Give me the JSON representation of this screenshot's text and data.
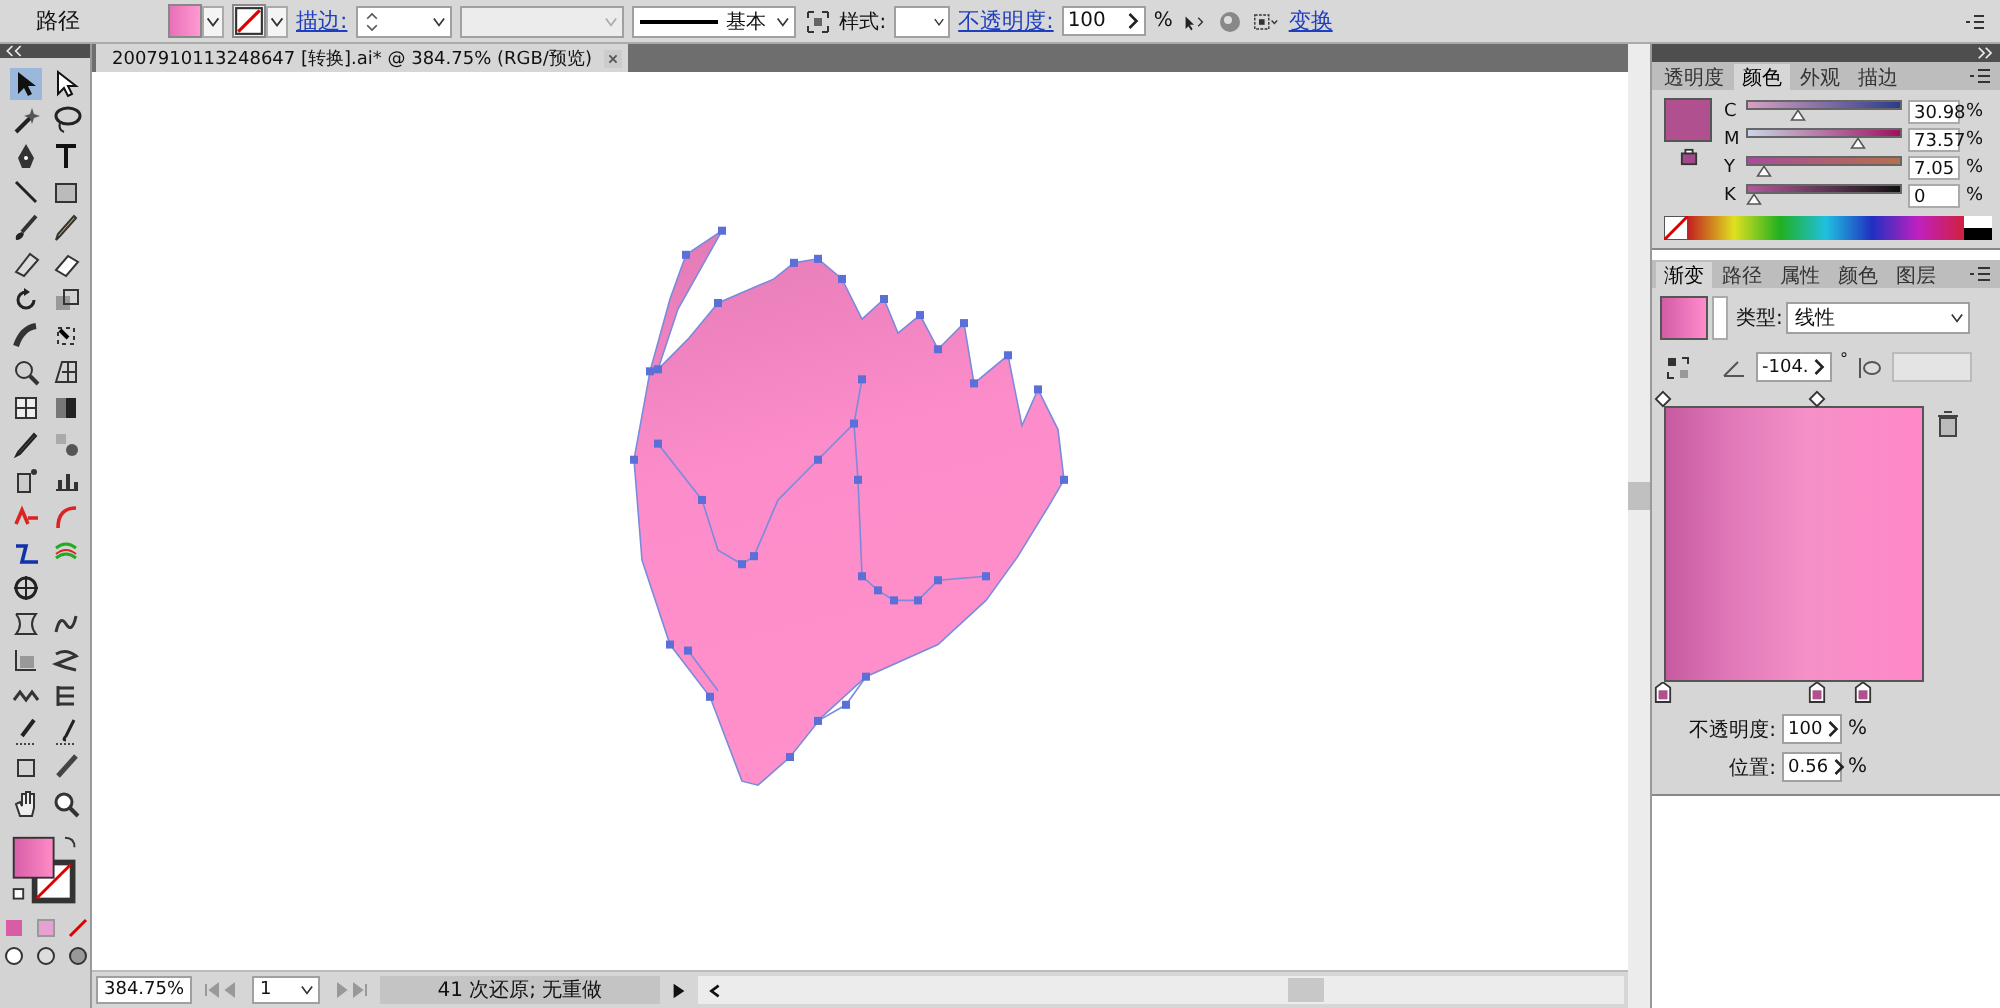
{
  "control_bar": {
    "label": "路径",
    "stroke_link": "描边:",
    "stroke_style": "基本",
    "style_label": "样式:",
    "opacity_link": "不透明度:",
    "opacity_value": "100",
    "opacity_unit": "%",
    "transform_link": "变换"
  },
  "document_tab": {
    "title": "2007910113248647  [转换].ai* @ 384.75% (RGB/预览)"
  },
  "color_panel": {
    "tabs": [
      {
        "label": "透明度",
        "selected": false
      },
      {
        "label": "颜色",
        "selected": true
      },
      {
        "label": "外观",
        "selected": false
      },
      {
        "label": "描边",
        "selected": false
      }
    ],
    "sliders": [
      {
        "name": "C",
        "level": 0.31,
        "value": "30.98",
        "unit": "%"
      },
      {
        "name": "M",
        "level": 0.74,
        "value": "73.57",
        "unit": "%"
      },
      {
        "name": "Y",
        "level": 0.07,
        "value": "7.05",
        "unit": "%"
      },
      {
        "name": "K",
        "level": 0,
        "value": "0",
        "unit": "%"
      }
    ]
  },
  "gradient_panel": {
    "tabs": [
      {
        "label": "渐变",
        "selected": true
      },
      {
        "label": "路径",
        "selected": false
      },
      {
        "label": "属性",
        "selected": false
      },
      {
        "label": "颜色",
        "selected": false
      },
      {
        "label": "图层",
        "selected": false
      }
    ],
    "type_label": "类型:",
    "type_value": "线性",
    "angle_value": "-104.",
    "angle_unit": "°",
    "stops": [
      {
        "level": 0
      },
      {
        "level": 0.59
      },
      {
        "level": 0.77
      }
    ],
    "opacity_label": "不透明度:",
    "opacity_value": "100",
    "opacity_unit": "%",
    "position_label": "位置:",
    "position_value": "0.56",
    "position_unit": "%"
  },
  "status_bar": {
    "zoom": "384.75%",
    "page": "1",
    "status": "41 次还原; 无重做"
  }
}
